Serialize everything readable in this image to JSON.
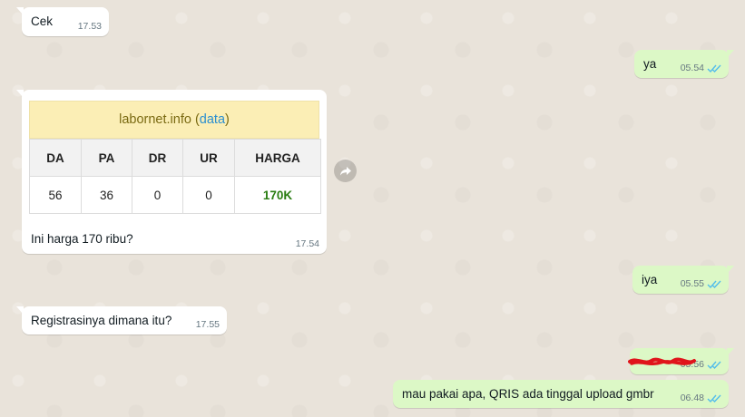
{
  "messages": {
    "m1": {
      "text": "Cek",
      "time": "17.53"
    },
    "m2": {
      "text": "ya",
      "time": "05.54"
    },
    "m3": {
      "preview": {
        "site": "labornet.info",
        "paren_open": "(",
        "link": "data",
        "paren_close": ")",
        "headers": [
          "DA",
          "PA",
          "DR",
          "UR",
          "HARGA"
        ],
        "values": [
          "56",
          "36",
          "0",
          "0",
          "170K"
        ]
      },
      "text": "Ini harga 170 ribu?",
      "time": "17.54"
    },
    "m4": {
      "text": "iya",
      "time": "05.55"
    },
    "m5": {
      "text": "Registrasinya dimana itu?",
      "time": "17.55"
    },
    "m6": {
      "time": "05.56"
    },
    "m7": {
      "text": "mau pakai apa, QRIS ada tinggal upload gmbr",
      "time": "06.48"
    }
  },
  "colors": {
    "incoming_bubble": "#ffffff",
    "outgoing_bubble": "#dcf8c6",
    "read_ticks": "#53bdeb",
    "price_green": "#2a7d12",
    "redaction": "#e0141b"
  },
  "icons": {
    "ticks": "double-check-read-icon",
    "forward": "forward-arrow-icon"
  }
}
